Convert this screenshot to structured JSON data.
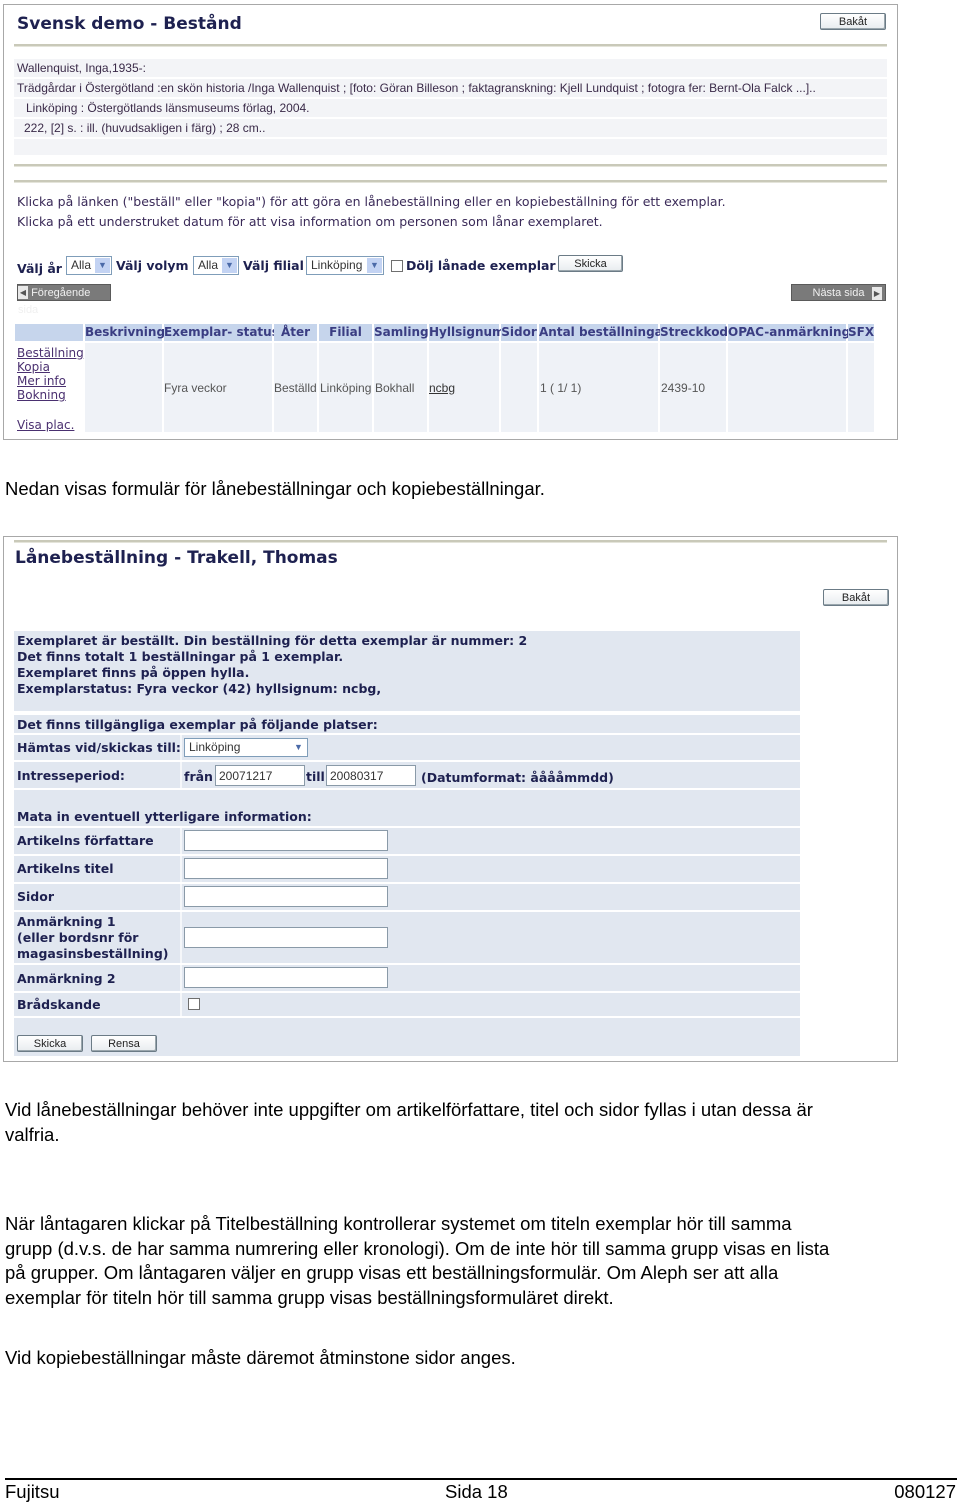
{
  "screen1": {
    "title": "Svensk demo - Bestånd",
    "back_button": "Bakåt",
    "bib_lines": [
      "Wallenquist, Inga,1935-:",
      "Trädgårdar i Östergötland :en skön historia /Inga Wallenquist ; [foto: Göran Billeson ; faktagranskning: Kjell Lundquist ; fotogra fer: Bernt-Ola Falck ...]..",
      "  Linköping : Östergötlands länsmuseums förlag, 2004.",
      " 222, [2] s. :  ill. (huvudsakligen i färg) ;  28 cm.."
    ],
    "instructions": [
      "Klicka på länken (\"beställ\" eller \"kopia\") för att göra en lånebeställning eller en kopiebeställning för ett exemplar.",
      "Klicka på ett understruket datum för att visa information om personen som lånar exemplaret."
    ],
    "filters": {
      "year_label": "Välj år",
      "year_value": "Alla",
      "volume_label": "Välj volym",
      "volume_value": "Alla",
      "branch_label": "Välj filial",
      "branch_value": "Linköping",
      "hide_loaned_label": "Dölj lånade exemplar",
      "hide_loaned_checked": false,
      "submit_label": "Skicka"
    },
    "prev_page": "Föregående sida",
    "next_page": "Nästa sida",
    "table": {
      "headers": [
        "Beskrivning",
        "Exemplar- status",
        "Åter",
        "Filial",
        "Samling",
        "Hyllsignum",
        "Sidor",
        "Antal beställningar",
        "Streckkod",
        "OPAC-anmärkning",
        "SFX"
      ],
      "links": [
        "Beställning",
        "Kopia",
        "Mer info",
        "Bokning",
        "Visa plac."
      ],
      "row": {
        "beskrivning": "",
        "status": "Fyra veckor",
        "ater": "Beställd",
        "filial": "Linköping",
        "samling": "Bokhall",
        "hyllsignum": "ncbg",
        "sidor": "",
        "antal": "1 ( 1/ 1)",
        "streckkod": "2439-10",
        "opac": "",
        "sfx": ""
      }
    }
  },
  "para_intro": "Nedan visas formulär för lånebeställningar och kopiebeställningar.",
  "screen2": {
    "title": "Lånebeställning - Trakell, Thomas",
    "back_button": "Bakåt",
    "status_lines": [
      "Exemplaret är beställt. Din beställning för detta exemplar är nummer: 2",
      "Det finns totalt 1 beställningar på 1 exemplar.",
      "Exemplaret finns på öppen hylla.",
      "Exemplarstatus: Fyra veckor (42) hyllsignum: ncbg,"
    ],
    "available_text": "Det finns tillgängliga exemplar på följande platser:",
    "pickup_label": "Hämtas vid/skickas till:",
    "pickup_value": "Linköping",
    "interest_label": "Intresseperiod:",
    "from_label": "från",
    "from_value": "20071217",
    "to_label": "till",
    "to_value": "20080317",
    "date_format": "(Datumformat: ååååmmdd)",
    "extra_info": "Mata in eventuell ytterligare information:",
    "fields": [
      {
        "label": "Artikelns författare",
        "value": ""
      },
      {
        "label": "Artikelns titel",
        "value": ""
      },
      {
        "label": "Sidor",
        "value": ""
      },
      {
        "label": "Anmärkning 1\n(eller bordsnr för\nmagasinsbeställning)",
        "value": ""
      },
      {
        "label": "Anmärkning 2",
        "value": ""
      }
    ],
    "urgent_label": "Brådskande",
    "urgent_checked": false,
    "submit_label": "Skicka",
    "reset_label": "Rensa"
  },
  "para_loan": [
    "Vid lånebeställningar behöver inte uppgifter om artikelförfattare, titel och sidor fyllas i utan dessa är",
    "valfria."
  ],
  "para_title": [
    "När låntagaren klickar på Titelbeställning kontrollerar systemet om titeln exemplar hör till samma",
    "grupp (d.v.s. de har samma numrering eller kronologi). Om de inte hör till samma grupp visas en lista",
    "på grupper. Om låntagaren väljer en grupp visas ett beställningsformulär. Om Aleph ser att alla",
    "exemplar för titeln hör till samma grupp visas beställningsformuläret direkt."
  ],
  "para_copy": "Vid kopiebeställningar måste däremot åtminstone sidor anges.",
  "footer": {
    "left": "Fujitsu",
    "center": "Sida 18",
    "right": "080127"
  }
}
